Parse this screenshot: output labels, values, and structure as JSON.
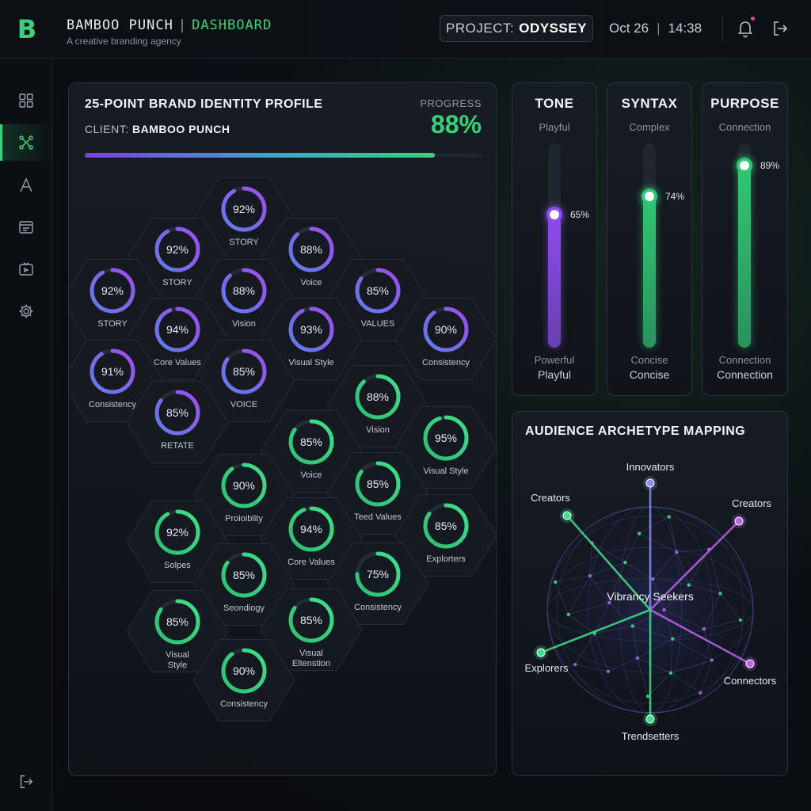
{
  "header": {
    "logo_letter": "B",
    "brand": "BAMBOO PUNCH",
    "separator": "|",
    "section": "DASHBOARD",
    "tagline": "A creative branding agency",
    "project_label": "PROJECT:",
    "project_name": "ODYSSEY",
    "date": "Oct 26",
    "date_sep": "|",
    "time": "14:38"
  },
  "sidebar": {
    "items": [
      {
        "icon": "grid-icon",
        "active": false
      },
      {
        "icon": "nodes-icon",
        "active": true
      },
      {
        "icon": "typography-icon",
        "active": false
      },
      {
        "icon": "layout-icon",
        "active": false
      },
      {
        "icon": "media-icon",
        "active": false
      },
      {
        "icon": "gear-icon",
        "active": false
      }
    ],
    "bottom_icon": "logout-icon"
  },
  "profile": {
    "title": "25-POINT BRAND IDENTITY PROFILE",
    "client_label": "CLIENT:",
    "client_name": "BAMBOO PUNCH",
    "progress_label": "PROGRESS",
    "progress_value": "88%",
    "progress_fraction": 0.88,
    "cells": [
      {
        "value": 92,
        "label": [
          "STORY"
        ],
        "color": "purple"
      },
      {
        "value": 92,
        "label": [
          "STORY"
        ],
        "color": "purple"
      },
      {
        "value": 88,
        "label": [
          "Voice"
        ],
        "color": "purple"
      },
      {
        "value": 92,
        "label": [
          "STORY"
        ],
        "color": "purple"
      },
      {
        "value": 88,
        "label": [
          "Vision"
        ],
        "color": "purple"
      },
      {
        "value": 85,
        "label": [
          "VALUES"
        ],
        "color": "purple"
      },
      {
        "value": 94,
        "label": [
          "Core Values"
        ],
        "color": "purple"
      },
      {
        "value": 93,
        "label": [
          "Visual Style"
        ],
        "color": "purple"
      },
      {
        "value": 90,
        "label": [
          "Consistency"
        ],
        "color": "purple"
      },
      {
        "value": 91,
        "label": [
          "Consistency"
        ],
        "color": "purple"
      },
      {
        "value": 85,
        "label": [
          "VOICE"
        ],
        "color": "purple"
      },
      {
        "value": 85,
        "label": [
          "RETATE"
        ],
        "color": "purple"
      },
      {
        "value": 88,
        "label": [
          "Vision"
        ],
        "color": "green"
      },
      {
        "value": 85,
        "label": [
          "Voice"
        ],
        "color": "green"
      },
      {
        "value": 95,
        "label": [
          "Visual Style"
        ],
        "color": "green"
      },
      {
        "value": 90,
        "label": [
          "Proioiblity"
        ],
        "color": "green"
      },
      {
        "value": 85,
        "label": [
          "Teed Values"
        ],
        "color": "green"
      },
      {
        "value": 92,
        "label": [
          "Solpes"
        ],
        "color": "green"
      },
      {
        "value": 94,
        "label": [
          "Core Values"
        ],
        "color": "green"
      },
      {
        "value": 85,
        "label": [
          "Explorters"
        ],
        "color": "green"
      },
      {
        "value": 85,
        "label": [
          "Seondiogy"
        ],
        "color": "green"
      },
      {
        "value": 75,
        "label": [
          "Consistency"
        ],
        "color": "green"
      },
      {
        "value": 85,
        "label": [
          "Visual",
          "Style"
        ],
        "color": "green"
      },
      {
        "value": 85,
        "label": [
          "Visual",
          "Eltenstion"
        ],
        "color": "green"
      },
      {
        "value": 90,
        "label": [
          "Consistency"
        ],
        "color": "green"
      }
    ]
  },
  "sliders": [
    {
      "title": "TONE",
      "top_label": "Playful",
      "bottom_label_1": "Powerful",
      "bottom_label_2": "Playful",
      "value": 65,
      "value_text": "65%",
      "color": "#8d4bef"
    },
    {
      "title": "SYNTAX",
      "top_label": "Complex",
      "bottom_label_1": "Concise",
      "bottom_label_2": "Concise",
      "value": 74,
      "value_text": "74%",
      "color": "#2fc774"
    },
    {
      "title": "PURPOSE",
      "top_label": "Connection",
      "bottom_label_1": "Connection",
      "bottom_label_2": "Connection",
      "value": 89,
      "value_text": "89%",
      "color": "#2fc774"
    }
  ],
  "archetype": {
    "title": "AUDIENCE ARCHETYPE MAPPING",
    "center_label": "Vibrancy Seekers",
    "nodes": [
      {
        "name": "Innovators",
        "color": "#8b8ff0"
      },
      {
        "name": "Creators",
        "color": "#3de08a"
      },
      {
        "name": "Creators",
        "color": "#b864ee"
      },
      {
        "name": "Explorers",
        "color": "#3de08a"
      },
      {
        "name": "Connectors",
        "color": "#b864ee"
      },
      {
        "name": "Trendsetters",
        "color": "#3de08a"
      }
    ]
  },
  "colors": {
    "accent_green": "#34d27b",
    "accent_purple": "#8d4bef",
    "background": "#0b0e13"
  }
}
